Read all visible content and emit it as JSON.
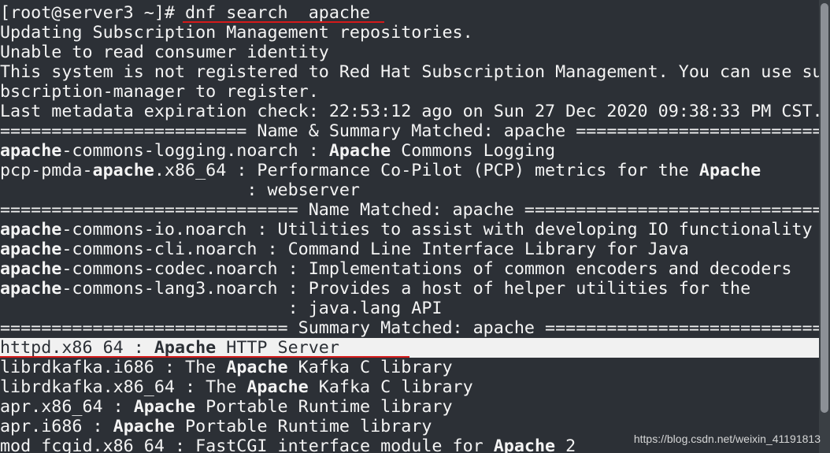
{
  "terminal": {
    "lines": [
      [
        {
          "t": "[root@server3 ~]# "
        },
        {
          "t": "dnf search  apache "
        }
      ],
      [
        {
          "t": "Updating Subscription Management repositories."
        }
      ],
      [
        {
          "t": "Unable to read consumer identity"
        }
      ],
      [
        {
          "t": "This system is not registered to Red Hat Subscription Management. You can use su"
        }
      ],
      [
        {
          "t": "bscription-manager to register."
        }
      ],
      [
        {
          "t": "Last metadata expiration check: 22:53:12 ago on Sun 27 Dec 2020 09:38:33 PM CST."
        }
      ],
      [
        {
          "t": "======================== Name & Summary Matched: apache ========================="
        }
      ],
      [
        {
          "t": "apache",
          "b": true
        },
        {
          "t": "-commons-logging.noarch : "
        },
        {
          "t": "Apache",
          "b": true
        },
        {
          "t": " Commons Logging"
        }
      ],
      [
        {
          "t": "pcp-pmda-"
        },
        {
          "t": "apache",
          "b": true
        },
        {
          "t": ".x86_64 : Performance Co-Pilot (PCP) metrics for the "
        },
        {
          "t": "Apache",
          "b": true
        }
      ],
      [
        {
          "t": "                        : webserver"
        }
      ],
      [
        {
          "t": "============================= Name Matched: apache =============================="
        }
      ],
      [
        {
          "t": "apache",
          "b": true
        },
        {
          "t": "-commons-io.noarch : Utilities to assist with developing IO functionality"
        }
      ],
      [
        {
          "t": "apache",
          "b": true
        },
        {
          "t": "-commons-cli.noarch : Command Line Interface Library for Java"
        }
      ],
      [
        {
          "t": "apache",
          "b": true
        },
        {
          "t": "-commons-codec.noarch : Implementations of common encoders and decoders"
        }
      ],
      [
        {
          "t": "apache",
          "b": true
        },
        {
          "t": "-commons-lang3.noarch : Provides a host of helper utilities for the"
        }
      ],
      [
        {
          "t": "                            : java.lang API"
        }
      ],
      [
        {
          "t": "============================ Summary Matched: apache ============================"
        }
      ],
      [
        {
          "t": "httpd.x86_64 : "
        },
        {
          "t": "Apache",
          "b": true
        },
        {
          "t": " HTTP Server"
        }
      ],
      [
        {
          "t": "librdkafka.i686 : The "
        },
        {
          "t": "Apache",
          "b": true
        },
        {
          "t": " Kafka C library"
        }
      ],
      [
        {
          "t": "librdkafka.x86_64 : The "
        },
        {
          "t": "Apache",
          "b": true
        },
        {
          "t": " Kafka C library"
        }
      ],
      [
        {
          "t": "apr.x86_64 : "
        },
        {
          "t": "Apache",
          "b": true
        },
        {
          "t": " Portable Runtime library"
        }
      ],
      [
        {
          "t": "apr.i686 : "
        },
        {
          "t": "Apache",
          "b": true
        },
        {
          "t": " Portable Runtime library"
        }
      ],
      [
        {
          "t": "mod_fcgid.x86_64 : FastCGI interface module for "
        },
        {
          "t": "Apache",
          "b": true
        },
        {
          "t": " 2"
        }
      ]
    ],
    "highlighted_line": 17
  },
  "watermark": "https://blog.csdn.net/weixin_41191813",
  "colors": {
    "background": "#2c3036",
    "foreground": "#f4f4f4",
    "highlight": "#f1f1f1",
    "annotation": "#d51a1a"
  }
}
